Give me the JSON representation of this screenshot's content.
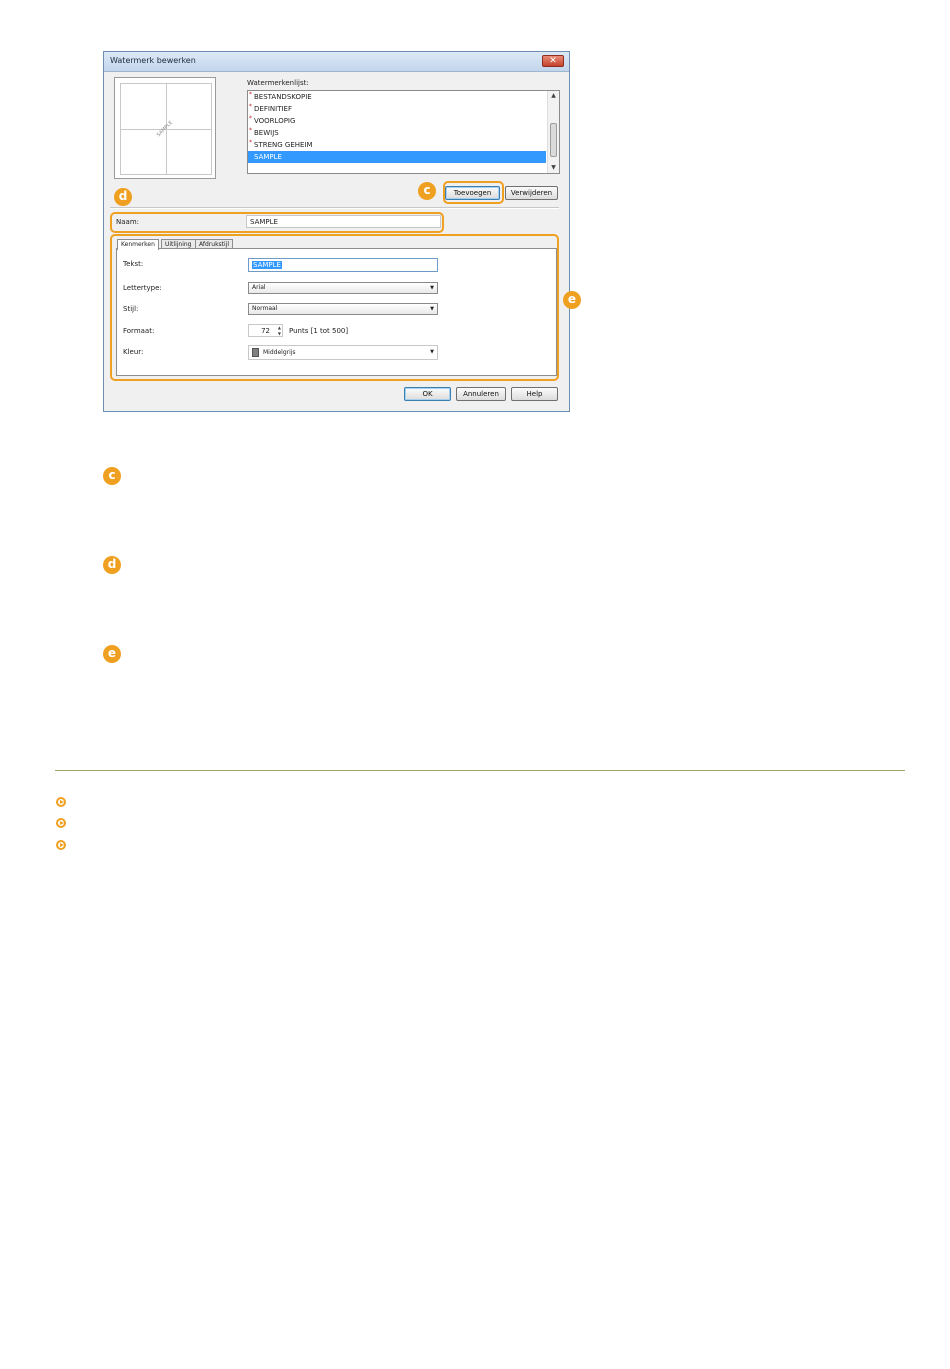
{
  "dialog": {
    "title": "Watermerk bewerken",
    "close_glyph": "✕"
  },
  "preview": {
    "watermark_text": "SAMPLE"
  },
  "watermark_list": {
    "label": "Watermerkenlijst:",
    "items": [
      {
        "label": "BESTANDSKOPIE",
        "marked": true,
        "selected": false
      },
      {
        "label": "DEFINITIEF",
        "marked": true,
        "selected": false
      },
      {
        "label": "VOORLOPIG",
        "marked": true,
        "selected": false
      },
      {
        "label": "BEWIJS",
        "marked": true,
        "selected": false
      },
      {
        "label": "STRENG GEHEIM",
        "marked": true,
        "selected": false
      },
      {
        "label": "SAMPLE",
        "marked": false,
        "selected": true
      }
    ],
    "mark_glyph": "*"
  },
  "buttons": {
    "add": "Toevoegen",
    "remove": "Verwijderen",
    "ok": "OK",
    "cancel": "Annuleren",
    "help": "Help"
  },
  "name_field": {
    "label": "Naam:",
    "value": "SAMPLE"
  },
  "tabs": [
    {
      "label": "Kenmerken",
      "active": true
    },
    {
      "label": "Uitlijning",
      "active": false
    },
    {
      "label": "Afdrukstijl",
      "active": false
    }
  ],
  "attributes": {
    "text_label": "Tekst:",
    "text_value": "SAMPLE",
    "font_label": "Lettertype:",
    "font_value": "Arial",
    "style_label": "Stijl:",
    "style_value": "Normaal",
    "size_label": "Formaat:",
    "size_value": "72",
    "size_unit": "Punts [1 tot 500]",
    "color_label": "Kleur:",
    "color_value": "Middelgrijs"
  },
  "badges": {
    "c": "c",
    "d": "d",
    "e": "e"
  },
  "colors": {
    "accent": "#f0a020",
    "selection": "#3399ff",
    "swatch": "#808080"
  }
}
